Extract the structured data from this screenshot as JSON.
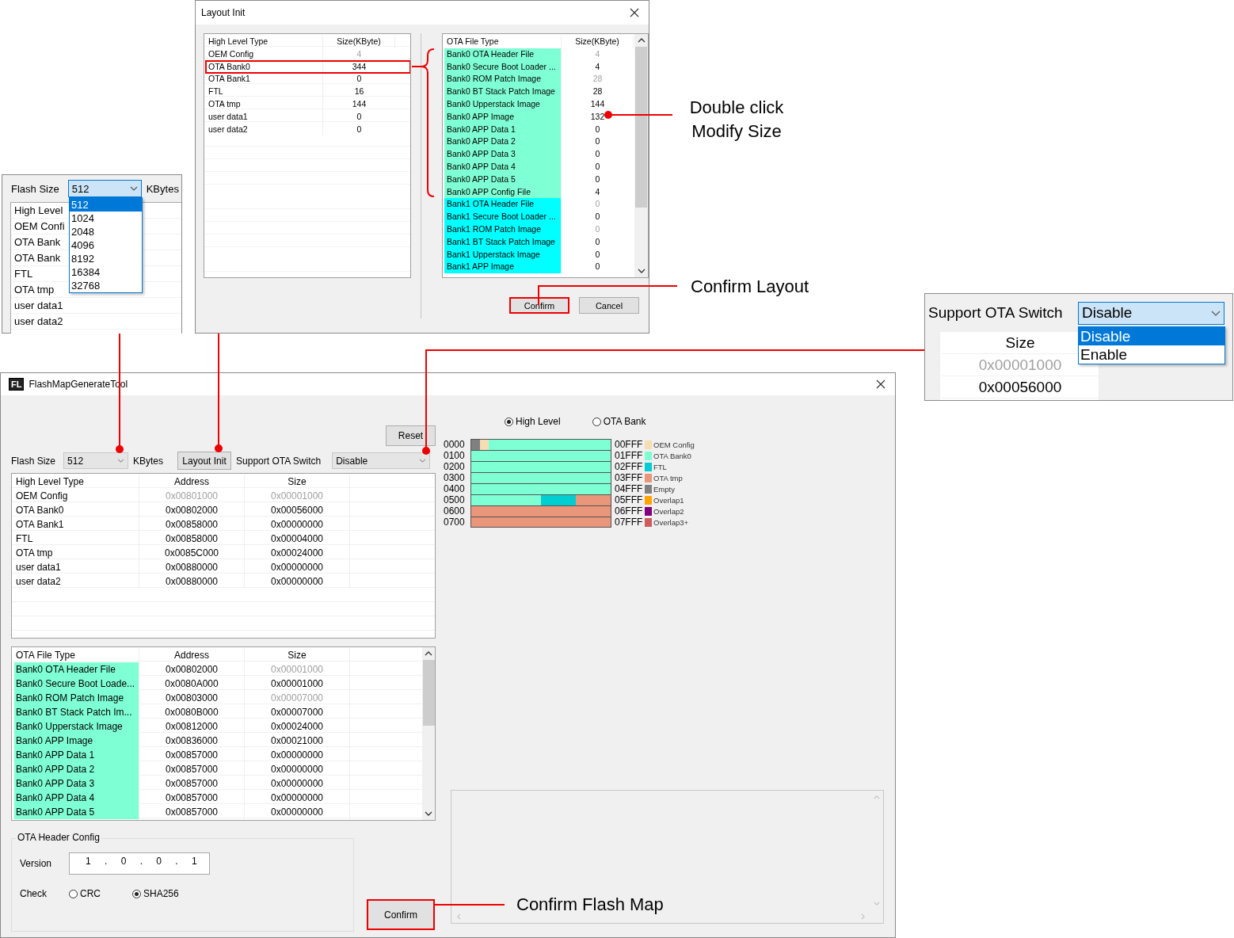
{
  "flash_size_inset": {
    "label": "Flash Size",
    "value": "512",
    "unit": "KBytes",
    "options": [
      {
        "label": "512",
        "selected": true
      },
      {
        "label": "1024",
        "selected": false
      },
      {
        "label": "2048",
        "selected": false
      },
      {
        "label": "4096",
        "selected": false
      },
      {
        "label": "8192",
        "selected": false
      },
      {
        "label": "16384",
        "selected": false
      },
      {
        "label": "32768",
        "selected": false
      }
    ],
    "rows": [
      "High Level",
      "OEM Confi",
      "OTA Bank",
      "OTA Bank",
      "FTL",
      "OTA tmp",
      "user data1",
      "user data2"
    ]
  },
  "layout_init_dialog": {
    "title": "Layout Init",
    "high_level_table": {
      "columns": [
        "High Level Type",
        "Size(KByte)"
      ],
      "rows": [
        {
          "type": "OEM Config",
          "size": "4",
          "disabled": true,
          "highlighted": false
        },
        {
          "type": "OTA Bank0",
          "size": "344",
          "disabled": false,
          "highlighted": true
        },
        {
          "type": "OTA Bank1",
          "size": "0",
          "disabled": false,
          "highlighted": false
        },
        {
          "type": "FTL",
          "size": "16",
          "disabled": false,
          "highlighted": false
        },
        {
          "type": "OTA tmp",
          "size": "144",
          "disabled": false,
          "highlighted": false
        },
        {
          "type": "user data1",
          "size": "0",
          "disabled": false,
          "highlighted": false
        },
        {
          "type": "user data2",
          "size": "0",
          "disabled": false,
          "highlighted": false
        }
      ]
    },
    "ota_table": {
      "columns": [
        "OTA File Type",
        "Size(KByte)"
      ],
      "rows": [
        {
          "type": "Bank0 OTA Header File",
          "size": "4",
          "disabled": true,
          "color": "#7fffd4"
        },
        {
          "type": "Bank0 Secure Boot Loader ...",
          "size": "4",
          "disabled": false,
          "color": "#7fffd4"
        },
        {
          "type": "Bank0 ROM Patch Image",
          "size": "28",
          "disabled": true,
          "color": "#7fffd4"
        },
        {
          "type": "Bank0 BT Stack Patch Image",
          "size": "28",
          "disabled": false,
          "color": "#7fffd4"
        },
        {
          "type": "Bank0 Upperstack Image",
          "size": "144",
          "disabled": false,
          "color": "#7fffd4"
        },
        {
          "type": "Bank0 APP Image",
          "size": "132",
          "disabled": false,
          "color": "#7fffd4"
        },
        {
          "type": "Bank0 APP Data 1",
          "size": "0",
          "disabled": false,
          "color": "#7fffd4"
        },
        {
          "type": "Bank0 APP Data 2",
          "size": "0",
          "disabled": false,
          "color": "#7fffd4"
        },
        {
          "type": "Bank0 APP Data 3",
          "size": "0",
          "disabled": false,
          "color": "#7fffd4"
        },
        {
          "type": "Bank0 APP Data 4",
          "size": "0",
          "disabled": false,
          "color": "#7fffd4"
        },
        {
          "type": "Bank0 APP Data 5",
          "size": "0",
          "disabled": false,
          "color": "#7fffd4"
        },
        {
          "type": "Bank0 APP Config File",
          "size": "4",
          "disabled": false,
          "color": "#7fffd4"
        },
        {
          "type": "Bank1 OTA Header File",
          "size": "0",
          "disabled": true,
          "color": "#00ffff"
        },
        {
          "type": "Bank1 Secure Boot Loader ...",
          "size": "0",
          "disabled": false,
          "color": "#00ffff"
        },
        {
          "type": "Bank1 ROM Patch Image",
          "size": "0",
          "disabled": true,
          "color": "#00ffff"
        },
        {
          "type": "Bank1 BT Stack Patch Image",
          "size": "0",
          "disabled": false,
          "color": "#00ffff"
        },
        {
          "type": "Bank1 Upperstack Image",
          "size": "0",
          "disabled": false,
          "color": "#00ffff"
        },
        {
          "type": "Bank1 APP Image",
          "size": "0",
          "disabled": false,
          "color": "#00ffff"
        }
      ]
    },
    "buttons": [
      {
        "label": "Confirm",
        "highlighted": true
      },
      {
        "label": "Cancel",
        "highlighted": false
      }
    ]
  },
  "annotations": {
    "modify_size": [
      "Double click",
      "Modify Size"
    ],
    "confirm_layout": "Confirm Layout",
    "confirm_flash_map": "Confirm Flash Map"
  },
  "ota_switch_inset": {
    "label": "Support OTA Switch",
    "value": "Disable",
    "options": [
      {
        "label": "Disable",
        "selected": true
      },
      {
        "label": "Enable",
        "selected": false
      }
    ],
    "column": "Size",
    "cells": [
      {
        "text": "0x00001000",
        "disabled": true
      },
      {
        "text": "0x00056000",
        "disabled": false
      }
    ]
  },
  "main_window": {
    "icon_letters": "FL",
    "title": "FlashMapGenerateTool",
    "reset": "Reset",
    "flash_size_label": "Flash Size",
    "flash_size_value": "512",
    "unit": "KBytes",
    "layout_init": "Layout Init",
    "ota_switch_label": "Support OTA Switch",
    "ota_switch_value": "Disable",
    "high_level_table": {
      "columns": [
        "High Level Type",
        "Address",
        "Size"
      ],
      "rows": [
        {
          "type": "OEM Config",
          "address": "0x00801000",
          "size": "0x00001000",
          "disabled": true
        },
        {
          "type": "OTA Bank0",
          "address": "0x00802000",
          "size": "0x00056000",
          "disabled": false
        },
        {
          "type": "OTA Bank1",
          "address": "0x00858000",
          "size": "0x00000000",
          "disabled": false
        },
        {
          "type": "FTL",
          "address": "0x00858000",
          "size": "0x00004000",
          "disabled": false
        },
        {
          "type": "OTA tmp",
          "address": "0x0085C000",
          "size": "0x00024000",
          "disabled": false
        },
        {
          "type": "user data1",
          "address": "0x00880000",
          "size": "0x00000000",
          "disabled": false
        },
        {
          "type": "user data2",
          "address": "0x00880000",
          "size": "0x00000000",
          "disabled": false
        }
      ]
    },
    "ota_table": {
      "columns": [
        "OTA File Type",
        "Address",
        "Size"
      ],
      "rows": [
        {
          "type": "Bank0 OTA Header File",
          "address": "0x00802000",
          "size": "0x00001000",
          "size_disabled": true,
          "color": "#7fffd4"
        },
        {
          "type": "Bank0 Secure Boot Loade...",
          "address": "0x0080A000",
          "size": "0x00001000",
          "size_disabled": false,
          "color": "#7fffd4"
        },
        {
          "type": "Bank0 ROM Patch Image",
          "address": "0x00803000",
          "size": "0x00007000",
          "size_disabled": true,
          "color": "#7fffd4"
        },
        {
          "type": "Bank0 BT Stack Patch Im...",
          "address": "0x0080B000",
          "size": "0x00007000",
          "size_disabled": false,
          "color": "#7fffd4"
        },
        {
          "type": "Bank0 Upperstack Image",
          "address": "0x00812000",
          "size": "0x00024000",
          "size_disabled": false,
          "color": "#7fffd4"
        },
        {
          "type": "Bank0 APP Image",
          "address": "0x00836000",
          "size": "0x00021000",
          "size_disabled": false,
          "color": "#7fffd4"
        },
        {
          "type": "Bank0 APP Data 1",
          "address": "0x00857000",
          "size": "0x00000000",
          "size_disabled": false,
          "color": "#7fffd4"
        },
        {
          "type": "Bank0 APP Data 2",
          "address": "0x00857000",
          "size": "0x00000000",
          "size_disabled": false,
          "color": "#7fffd4"
        },
        {
          "type": "Bank0 APP Data 3",
          "address": "0x00857000",
          "size": "0x00000000",
          "size_disabled": false,
          "color": "#7fffd4"
        },
        {
          "type": "Bank0 APP Data 4",
          "address": "0x00857000",
          "size": "0x00000000",
          "size_disabled": false,
          "color": "#7fffd4"
        },
        {
          "type": "Bank0 APP Data 5",
          "address": "0x00857000",
          "size": "0x00000000",
          "size_disabled": false,
          "color": "#7fffd4"
        }
      ]
    },
    "ota_header_config": {
      "title": "OTA Header Config",
      "version_label": "Version",
      "version": "1 . 0 . 0 . 1",
      "check_label": "Check",
      "check_options": [
        {
          "label": "CRC",
          "selected": false
        },
        {
          "label": "SHA256",
          "selected": true
        }
      ]
    },
    "confirm": {
      "label": "Confirm",
      "highlighted": true
    },
    "view_options": [
      {
        "label": "High Level",
        "selected": true
      },
      {
        "label": "OTA Bank",
        "selected": false
      }
    ],
    "flash_map": {
      "rows": [
        {
          "start": "0000",
          "end": "00FFF",
          "blocks": [
            {
              "color": "#808080"
            },
            {
              "color": "#f5deb3"
            },
            {
              "color": "#7fffd4"
            },
            {
              "color": "#7fffd4"
            },
            {
              "color": "#7fffd4"
            },
            {
              "color": "#7fffd4"
            },
            {
              "color": "#7fffd4"
            },
            {
              "color": "#7fffd4"
            },
            {
              "color": "#7fffd4"
            },
            {
              "color": "#7fffd4"
            },
            {
              "color": "#7fffd4"
            },
            {
              "color": "#7fffd4"
            },
            {
              "color": "#7fffd4"
            },
            {
              "color": "#7fffd4"
            },
            {
              "color": "#7fffd4"
            },
            {
              "color": "#7fffd4"
            }
          ]
        },
        {
          "start": "0100",
          "end": "01FFF",
          "blocks": [
            {
              "color": "#7fffd4"
            },
            {
              "color": "#7fffd4"
            },
            {
              "color": "#7fffd4"
            },
            {
              "color": "#7fffd4"
            },
            {
              "color": "#7fffd4"
            },
            {
              "color": "#7fffd4"
            },
            {
              "color": "#7fffd4"
            },
            {
              "color": "#7fffd4"
            },
            {
              "color": "#7fffd4"
            },
            {
              "color": "#7fffd4"
            },
            {
              "color": "#7fffd4"
            },
            {
              "color": "#7fffd4"
            },
            {
              "color": "#7fffd4"
            },
            {
              "color": "#7fffd4"
            },
            {
              "color": "#7fffd4"
            },
            {
              "color": "#7fffd4"
            }
          ]
        },
        {
          "start": "0200",
          "end": "02FFF",
          "blocks": [
            {
              "color": "#7fffd4"
            },
            {
              "color": "#7fffd4"
            },
            {
              "color": "#7fffd4"
            },
            {
              "color": "#7fffd4"
            },
            {
              "color": "#7fffd4"
            },
            {
              "color": "#7fffd4"
            },
            {
              "color": "#7fffd4"
            },
            {
              "color": "#7fffd4"
            },
            {
              "color": "#7fffd4"
            },
            {
              "color": "#7fffd4"
            },
            {
              "color": "#7fffd4"
            },
            {
              "color": "#7fffd4"
            },
            {
              "color": "#7fffd4"
            },
            {
              "color": "#7fffd4"
            },
            {
              "color": "#7fffd4"
            },
            {
              "color": "#7fffd4"
            }
          ]
        },
        {
          "start": "0300",
          "end": "03FFF",
          "blocks": [
            {
              "color": "#7fffd4"
            },
            {
              "color": "#7fffd4"
            },
            {
              "color": "#7fffd4"
            },
            {
              "color": "#7fffd4"
            },
            {
              "color": "#7fffd4"
            },
            {
              "color": "#7fffd4"
            },
            {
              "color": "#7fffd4"
            },
            {
              "color": "#7fffd4"
            },
            {
              "color": "#7fffd4"
            },
            {
              "color": "#7fffd4"
            },
            {
              "color": "#7fffd4"
            },
            {
              "color": "#7fffd4"
            },
            {
              "color": "#7fffd4"
            },
            {
              "color": "#7fffd4"
            },
            {
              "color": "#7fffd4"
            },
            {
              "color": "#7fffd4"
            }
          ]
        },
        {
          "start": "0400",
          "end": "04FFF",
          "blocks": [
            {
              "color": "#7fffd4"
            },
            {
              "color": "#7fffd4"
            },
            {
              "color": "#7fffd4"
            },
            {
              "color": "#7fffd4"
            },
            {
              "color": "#7fffd4"
            },
            {
              "color": "#7fffd4"
            },
            {
              "color": "#7fffd4"
            },
            {
              "color": "#7fffd4"
            },
            {
              "color": "#7fffd4"
            },
            {
              "color": "#7fffd4"
            },
            {
              "color": "#7fffd4"
            },
            {
              "color": "#7fffd4"
            },
            {
              "color": "#7fffd4"
            },
            {
              "color": "#7fffd4"
            },
            {
              "color": "#7fffd4"
            },
            {
              "color": "#7fffd4"
            }
          ]
        },
        {
          "start": "0500",
          "end": "05FFF",
          "blocks": [
            {
              "color": "#7fffd4"
            },
            {
              "color": "#7fffd4"
            },
            {
              "color": "#7fffd4"
            },
            {
              "color": "#7fffd4"
            },
            {
              "color": "#7fffd4"
            },
            {
              "color": "#7fffd4"
            },
            {
              "color": "#7fffd4"
            },
            {
              "color": "#7fffd4"
            },
            {
              "color": "#00ced1"
            },
            {
              "color": "#00ced1"
            },
            {
              "color": "#00ced1"
            },
            {
              "color": "#00ced1"
            },
            {
              "color": "#e9967a"
            },
            {
              "color": "#e9967a"
            },
            {
              "color": "#e9967a"
            },
            {
              "color": "#e9967a"
            }
          ]
        },
        {
          "start": "0600",
          "end": "06FFF",
          "blocks": [
            {
              "color": "#e9967a"
            },
            {
              "color": "#e9967a"
            },
            {
              "color": "#e9967a"
            },
            {
              "color": "#e9967a"
            },
            {
              "color": "#e9967a"
            },
            {
              "color": "#e9967a"
            },
            {
              "color": "#e9967a"
            },
            {
              "color": "#e9967a"
            },
            {
              "color": "#e9967a"
            },
            {
              "color": "#e9967a"
            },
            {
              "color": "#e9967a"
            },
            {
              "color": "#e9967a"
            },
            {
              "color": "#e9967a"
            },
            {
              "color": "#e9967a"
            },
            {
              "color": "#e9967a"
            },
            {
              "color": "#e9967a"
            }
          ]
        },
        {
          "start": "0700",
          "end": "07FFF",
          "blocks": [
            {
              "color": "#e9967a"
            },
            {
              "color": "#e9967a"
            },
            {
              "color": "#e9967a"
            },
            {
              "color": "#e9967a"
            },
            {
              "color": "#e9967a"
            },
            {
              "color": "#e9967a"
            },
            {
              "color": "#e9967a"
            },
            {
              "color": "#e9967a"
            },
            {
              "color": "#e9967a"
            },
            {
              "color": "#e9967a"
            },
            {
              "color": "#e9967a"
            },
            {
              "color": "#e9967a"
            },
            {
              "color": "#e9967a"
            },
            {
              "color": "#e9967a"
            },
            {
              "color": "#e9967a"
            },
            {
              "color": "#e9967a"
            }
          ]
        }
      ],
      "legend": [
        {
          "label": "OEM Config",
          "color": "#f5deb3"
        },
        {
          "label": "OTA Bank0",
          "color": "#7fffd4"
        },
        {
          "label": "FTL",
          "color": "#00ced1"
        },
        {
          "label": "OTA tmp",
          "color": "#e9967a"
        },
        {
          "label": "Empty",
          "color": "#808080"
        },
        {
          "label": "Overlap1",
          "color": "#ffa500"
        },
        {
          "label": "Overlap2",
          "color": "#800080"
        },
        {
          "label": "Overlap3+",
          "color": "#cd5c5c"
        }
      ]
    }
  }
}
